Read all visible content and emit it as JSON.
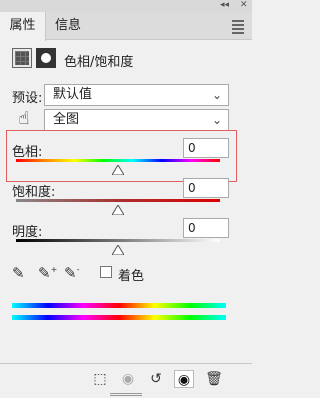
{
  "window": {
    "collapse_glyph": "◂◂",
    "close_glyph": "✕"
  },
  "tabs": [
    {
      "label": "属性",
      "active": true
    },
    {
      "label": "信息",
      "active": false
    }
  ],
  "header": {
    "title": "色相/饱和度",
    "icons": [
      "adjustment-layer-icon",
      "layer-mask-icon"
    ]
  },
  "preset": {
    "label": "预设:",
    "value": "默认值"
  },
  "channel": {
    "value": "全图"
  },
  "sliders": {
    "hue": {
      "label": "色相:",
      "value": "0",
      "level": 0.5,
      "range": [
        -180,
        180
      ]
    },
    "saturation": {
      "label": "饱和度:",
      "value": "0",
      "level": 0.5,
      "range": [
        -100,
        100
      ]
    },
    "lightness": {
      "label": "明度:",
      "value": "0",
      "level": 0.5,
      "range": [
        -100,
        100
      ]
    }
  },
  "colorize": {
    "label": "着色",
    "checked": false
  },
  "eyedroppers": [
    "eyedropper-icon",
    "eyedropper-add-icon",
    "eyedropper-subtract-icon"
  ],
  "bottom_icons": [
    "clip-to-layer-icon",
    "view-previous-icon",
    "reset-icon",
    "visibility-icon",
    "delete-icon"
  ],
  "colors": {
    "highlight_border": "#e06060",
    "panel_bg": "#f0f0f0"
  }
}
